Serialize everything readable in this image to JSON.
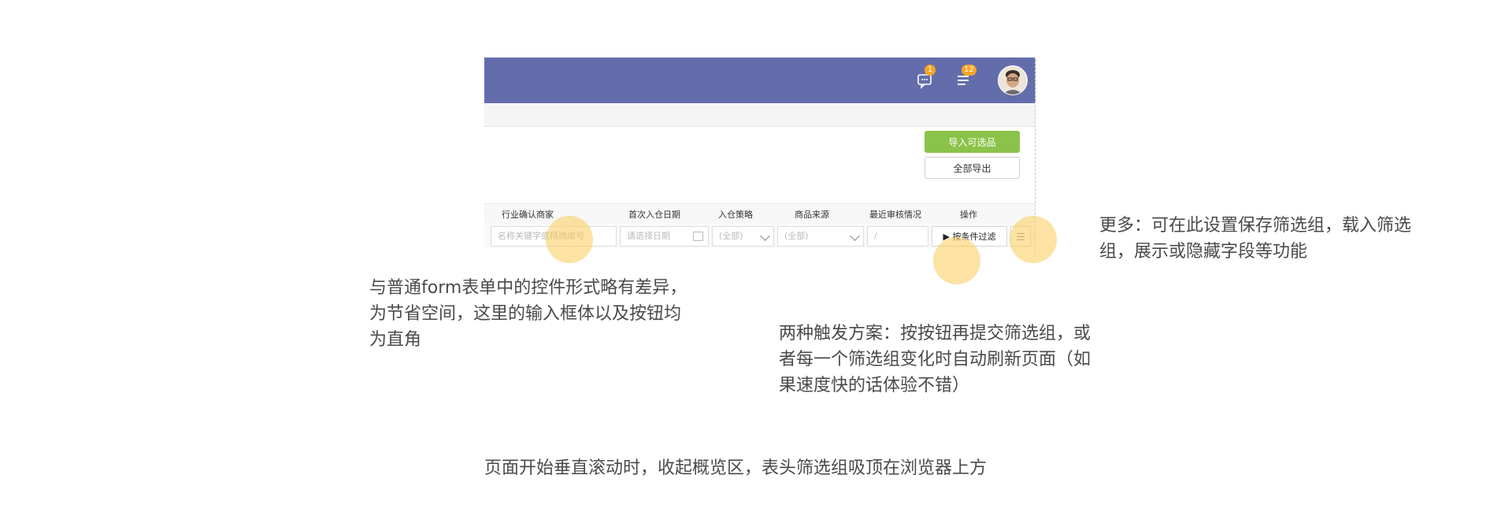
{
  "topbar": {
    "message_badge": "1",
    "list_badge": "12",
    "color": "#646dab"
  },
  "actions": {
    "import_label": "导入可选品",
    "export_label": "全部导出"
  },
  "columns": [
    "行业确认商家",
    "首次入仓日期",
    "入仓策略",
    "商品来源",
    "最近审核情况",
    "操作"
  ],
  "filters": {
    "merchant_placeholder": "名称关键字或精确编号",
    "date_placeholder": "请选择日期",
    "strategy_value": "(全部)",
    "source_value": "(全部)",
    "review_value": "/",
    "filter_button_label": "▶ 按条件过滤",
    "more_button_icon": "☰"
  },
  "annotations": {
    "input_note_line1": "与普通form表单中的控件形式略有差异，",
    "input_note_line2": "为节省空间，这里的输入框体以及按钮均",
    "input_note_line3": "为直角",
    "trigger_note_line1": "两种触发方案：按按钮再提交筛选组，或",
    "trigger_note_line2": "者每一个筛选组变化时自动刷新页面（如",
    "trigger_note_line3": "果速度快的话体验不错）",
    "more_note_line1": "更多：可在此设置保存筛选组，载入筛选",
    "more_note_line2": "组，展示或隐藏字段等功能",
    "sticky_note": "页面开始垂直滚动时，收起概览区，表头筛选组吸顶在浏览器上方"
  },
  "colors": {
    "accent_green": "#8bc34a",
    "badge_orange": "#f5a623",
    "highlight_dot": "#face66"
  }
}
